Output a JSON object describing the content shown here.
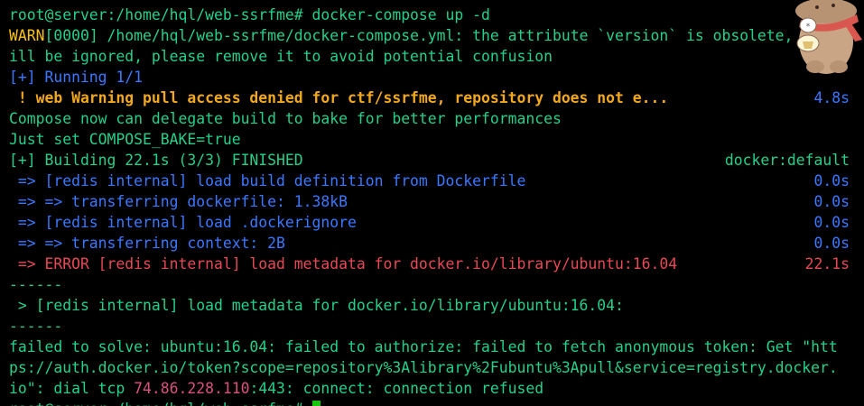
{
  "terminal": {
    "lines": [
      {
        "parts": [
          {
            "t": "root@server:/home/hql/web-ssrfme# docker-compose up -d",
            "c": "g"
          }
        ]
      },
      {
        "parts": [
          {
            "t": "WARN",
            "c": "y"
          },
          {
            "t": "[0000] /home/hql/web-ssrfme/docker-compose.yml: the attribute `version` is obsolete, it w",
            "c": "g"
          }
        ]
      },
      {
        "parts": [
          {
            "t": "ill be ignored, please remove it to avoid potential confusion",
            "c": "g"
          }
        ]
      },
      {
        "parts": [
          {
            "t": "[+] Running 1/1",
            "c": "b"
          }
        ]
      },
      {
        "parts": [
          {
            "t": " ! web Warning pull access denied for ctf/ssrfme, repository does not e...",
            "c": "o bold"
          }
        ],
        "right": {
          "t": "4.8s",
          "c": "b"
        }
      },
      {
        "parts": [
          {
            "t": "Compose now can delegate build to bake for better performances",
            "c": "g"
          }
        ]
      },
      {
        "parts": [
          {
            "t": "Just set COMPOSE_BAKE=true",
            "c": "g"
          }
        ]
      },
      {
        "parts": [
          {
            "t": "[+] Building 22.1s (3/3) FINISHED",
            "c": "g"
          }
        ],
        "right": {
          "t": "docker:default",
          "c": "g"
        }
      },
      {
        "parts": [
          {
            "t": " => [redis internal] load build definition from Dockerfile",
            "c": "b"
          }
        ],
        "right": {
          "t": "0.0s",
          "c": "b"
        }
      },
      {
        "parts": [
          {
            "t": " => => transferring dockerfile: 1.38kB",
            "c": "b"
          }
        ],
        "right": {
          "t": "0.0s",
          "c": "b"
        }
      },
      {
        "parts": [
          {
            "t": " => [redis internal] load .dockerignore",
            "c": "b"
          }
        ],
        "right": {
          "t": "0.0s",
          "c": "b"
        }
      },
      {
        "parts": [
          {
            "t": " => => transferring context: 2B",
            "c": "b"
          }
        ],
        "right": {
          "t": "0.0s",
          "c": "b"
        }
      },
      {
        "parts": [
          {
            "t": " => ERROR [redis internal] load metadata for docker.io/library/ubuntu:16.04",
            "c": "r"
          }
        ],
        "right": {
          "t": "22.1s",
          "c": "r"
        }
      },
      {
        "parts": [
          {
            "t": "------",
            "c": "g"
          }
        ]
      },
      {
        "parts": [
          {
            "t": " > [redis internal] load metadata for docker.io/library/ubuntu:16.04:",
            "c": "g"
          }
        ]
      },
      {
        "parts": [
          {
            "t": "------",
            "c": "g"
          }
        ]
      },
      {
        "parts": [
          {
            "t": "failed to solve: ubuntu:16.04: failed to authorize: failed to fetch anonymous token: Get \"htt",
            "c": "g"
          }
        ]
      },
      {
        "parts": [
          {
            "t": "ps://auth.docker.io/token?scope=repository%3Alibrary%2Fubuntu%3Apull&service=registry.docker.",
            "c": "g"
          }
        ]
      },
      {
        "parts": [
          {
            "t": "io\": dial tcp ",
            "c": "g"
          },
          {
            "t": "74.86.228.110",
            "c": "pk"
          },
          {
            "t": ":443: connect: connection refused",
            "c": "g"
          }
        ]
      },
      {
        "parts": [
          {
            "t": "root@server:/home/hql/web-ssrfme# ",
            "c": "g"
          }
        ],
        "cursor": true
      }
    ]
  },
  "sticker": {
    "icon": "bear-sticker-icon"
  },
  "colors": {
    "background": "#000000",
    "prompt_green": "#23d18b",
    "info_blue": "#3b78ff",
    "warn_orange": "#f2a81d",
    "warn_label_yellow": "#f9c01a",
    "error_red": "#e74856",
    "ip_pink": "#d8527e",
    "cursor_green": "#16c60c"
  }
}
